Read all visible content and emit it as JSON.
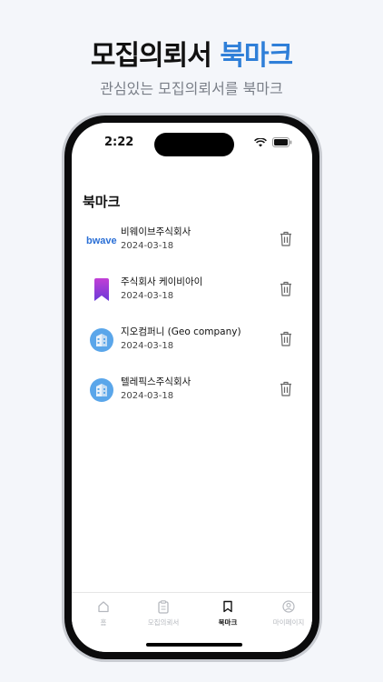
{
  "hero": {
    "title_main": "모집의뢰서",
    "title_accent": "북마크",
    "subtitle": "관심있는 모집의뢰서를 북마크"
  },
  "status_bar": {
    "time": "2:22"
  },
  "screen": {
    "title": "북마크"
  },
  "bookmarks": [
    {
      "name": "비웨이브주식회사",
      "date": "2024-03-18",
      "logo_text": "bwave",
      "logo_icon": "bwave-logo-icon"
    },
    {
      "name": "주식회사 케이비아이",
      "date": "2024-03-18",
      "logo_icon": "bookmark-ribbon-icon"
    },
    {
      "name": "지오컴퍼니 (Geo company)",
      "date": "2024-03-18",
      "logo_icon": "building-icon"
    },
    {
      "name": "텔레픽스주식회사",
      "date": "2024-03-18",
      "logo_icon": "building-icon"
    }
  ],
  "tabs": [
    {
      "label": "홈",
      "icon": "home-icon",
      "active": false
    },
    {
      "label": "모집의뢰서",
      "icon": "clipboard-icon",
      "active": false
    },
    {
      "label": "북마크",
      "icon": "bookmark-icon",
      "active": true
    },
    {
      "label": "마이페이지",
      "icon": "user-icon",
      "active": false
    }
  ],
  "colors": {
    "accent": "#2f7fd8",
    "background": "#f4f6fa",
    "tab_inactive": "#b5b8be"
  }
}
